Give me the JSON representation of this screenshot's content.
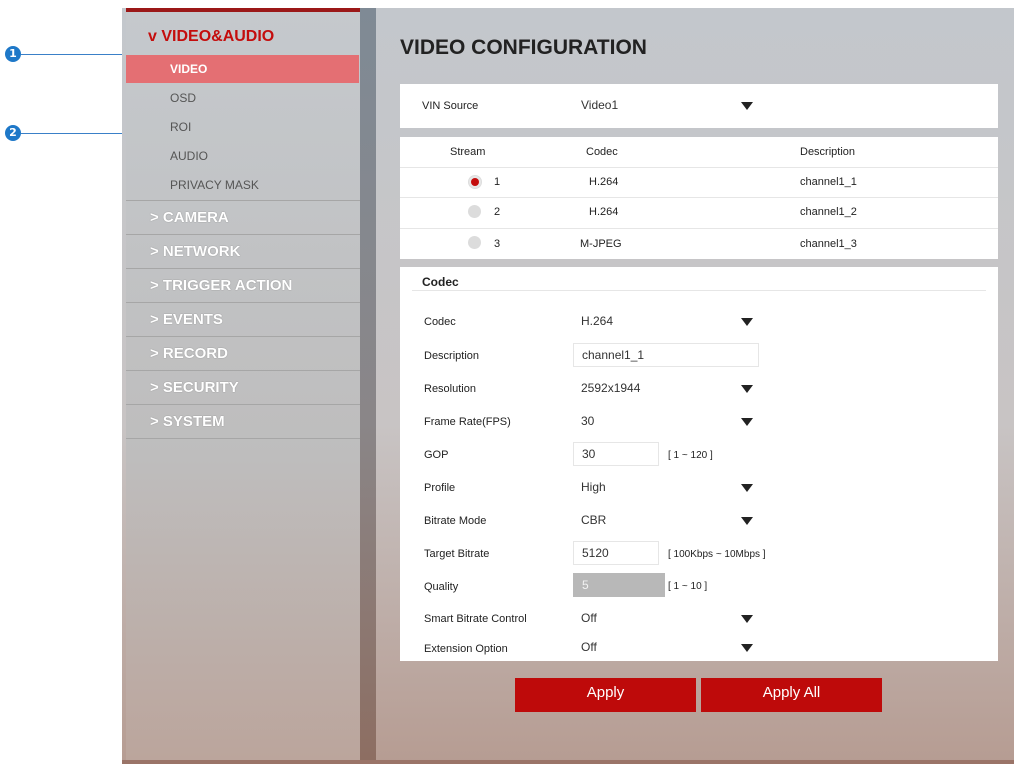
{
  "callouts": [
    "1",
    "2"
  ],
  "sidebar": {
    "head": "v VIDEO&AUDIO",
    "sub_items": [
      {
        "label": "VIDEO",
        "active": true
      },
      {
        "label": "OSD",
        "active": false
      },
      {
        "label": "ROI",
        "active": false
      },
      {
        "label": "AUDIO",
        "active": false
      },
      {
        "label": "PRIVACY MASK",
        "active": false
      }
    ],
    "sections": [
      "> CAMERA",
      "> NETWORK",
      "> TRIGGER ACTION",
      "> EVENTS",
      "> RECORD",
      "> SECURITY",
      "> SYSTEM"
    ]
  },
  "page": {
    "title": "VIDEO CONFIGURATION",
    "vin_label": "VIN Source",
    "vin_value": "Video1"
  },
  "stream_table": {
    "headers": [
      "Stream",
      "Codec",
      "Description"
    ],
    "rows": [
      {
        "stream": "1",
        "codec": "H.264",
        "description": "channel1_1",
        "selected": true
      },
      {
        "stream": "2",
        "codec": "H.264",
        "description": "channel1_2",
        "selected": false
      },
      {
        "stream": "3",
        "codec": "M-JPEG",
        "description": "channel1_3",
        "selected": false
      }
    ]
  },
  "codec": {
    "section_title": "Codec",
    "codec_label": "Codec",
    "codec_value": "H.264",
    "description_label": "Description",
    "description_value": "channel1_1",
    "resolution_label": "Resolution",
    "resolution_value": "2592x1944",
    "framerate_label": "Frame Rate(FPS)",
    "framerate_value": "30",
    "gop_label": "GOP",
    "gop_value": "30",
    "gop_range": "[ 1 ~ 120 ]",
    "profile_label": "Profile",
    "profile_value": "High",
    "bitrate_mode_label": "Bitrate Mode",
    "bitrate_mode_value": "CBR",
    "target_bitrate_label": "Target Bitrate",
    "target_bitrate_value": "5120",
    "target_bitrate_range": "[ 100Kbps ~ 10Mbps ]",
    "quality_label": "Quality",
    "quality_value": "5",
    "quality_range": "[ 1 ~ 10 ]",
    "smart_label": "Smart Bitrate Control",
    "smart_value": "Off",
    "extension_label": "Extension Option",
    "extension_value": "Off"
  },
  "buttons": {
    "apply": "Apply",
    "apply_all": "Apply All"
  },
  "colors": {
    "accent": "#c40d0d",
    "active_item": "#e46f73",
    "button": "#be0a0a",
    "callout": "#1e78c8"
  }
}
